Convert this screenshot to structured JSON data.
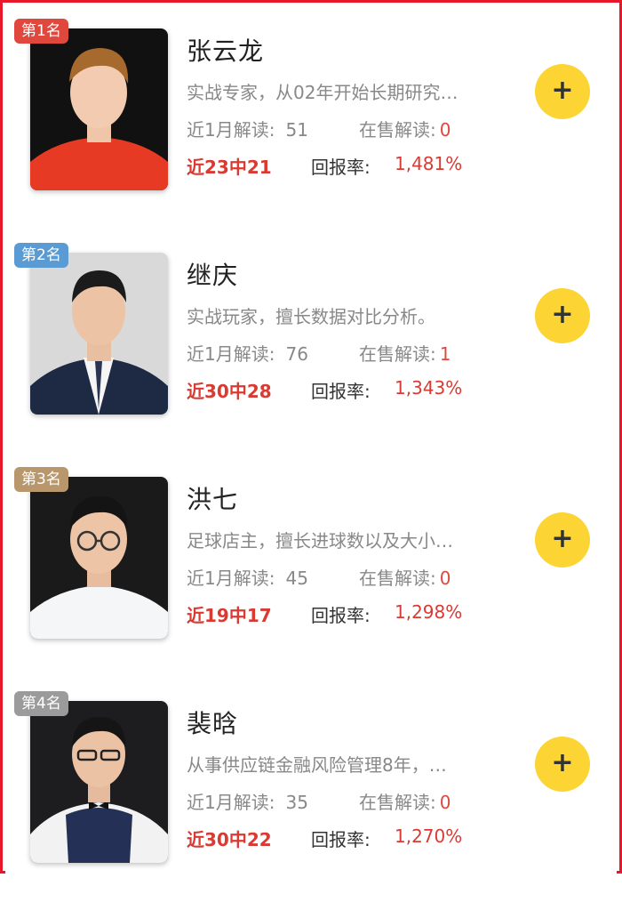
{
  "colors": {
    "rank1": "#e0473d",
    "rank2": "#5a9bd4",
    "rank3": "#b9976d",
    "rank4": "#9b9b9b",
    "accent_red": "#d93a32",
    "follow_yellow": "#fcd535"
  },
  "labels": {
    "recent_month": "近1月解读:",
    "on_sale": "在售解读:",
    "return_rate": "回报率:",
    "follow_icon": "+"
  },
  "experts": [
    {
      "rank_label": "第1名",
      "name": "张云龙",
      "desc": "实战专家，从02年开始长期研究…",
      "recent_count": "51",
      "on_sale_count": "0",
      "streak": "近23中21",
      "return_rate": "1,481%"
    },
    {
      "rank_label": "第2名",
      "name": "继庆",
      "desc": "实战玩家，擅长数据对比分析。",
      "recent_count": "76",
      "on_sale_count": "1",
      "streak": "近30中28",
      "return_rate": "1,343%"
    },
    {
      "rank_label": "第3名",
      "name": "洪七",
      "desc": "足球店主，擅长进球数以及大小…",
      "recent_count": "45",
      "on_sale_count": "0",
      "streak": "近19中17",
      "return_rate": "1,298%"
    },
    {
      "rank_label": "第4名",
      "name": "裴晗",
      "desc": "从事供应链金融风险管理8年，…",
      "recent_count": "35",
      "on_sale_count": "0",
      "streak": "近30中22",
      "return_rate": "1,270%"
    }
  ]
}
